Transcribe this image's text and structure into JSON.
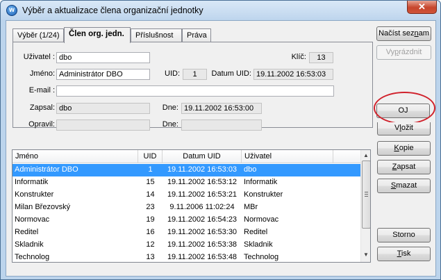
{
  "window": {
    "title": "Výběr a aktualizace člena organizační jednotky",
    "close_symbol": "✕",
    "app_icon_letter": "w"
  },
  "tabs": [
    {
      "label": "Výběr (1/24)"
    },
    {
      "label": "Člen org. jedn."
    },
    {
      "label": "Příslušnost"
    },
    {
      "label": "Práva"
    }
  ],
  "form": {
    "uzivatel_label": "Uživatel :",
    "uzivatel_value": "dbo",
    "klic_label": "Klíč:",
    "klic_value": "13",
    "jmeno_label": "Jméno:",
    "jmeno_value": "Administrátor DBO",
    "uid_label": "UID:",
    "uid_value": "1",
    "datum_uid_label": "Datum UID:",
    "datum_uid_value": "19.11.2002 16:53:03",
    "email_label": "E-mail :",
    "email_value": "",
    "zapsal_label": "Zapsal:",
    "zapsal_value": "dbo",
    "dne1_label": "Dne:",
    "dne1_value": "19.11.2002 16:53:00",
    "opravil_label": "Opravil:",
    "opravil_value": "",
    "dne2_label": "Dne:",
    "dne2_value": ""
  },
  "grid": {
    "columns": [
      "Jméno",
      "UID",
      "Datum UID",
      "Uživatel"
    ],
    "rows": [
      {
        "jmeno": "Administrátor DBO",
        "uid": "1",
        "datum": "19.11.2002 16:53:03",
        "uzivatel": "dbo"
      },
      {
        "jmeno": "Informatik",
        "uid": "15",
        "datum": "19.11.2002 16:53:12",
        "uzivatel": "Informatik"
      },
      {
        "jmeno": "Konstrukter",
        "uid": "14",
        "datum": "19.11.2002 16:53:21",
        "uzivatel": "Konstrukter"
      },
      {
        "jmeno": "Milan Březovský",
        "uid": "23",
        "datum": "9.11.2006 11:02:24",
        "uzivatel": "MBr"
      },
      {
        "jmeno": "Normovac",
        "uid": "19",
        "datum": "19.11.2002 16:54:23",
        "uzivatel": "Normovac"
      },
      {
        "jmeno": "Reditel",
        "uid": "16",
        "datum": "19.11.2002 16:53:30",
        "uzivatel": "Reditel"
      },
      {
        "jmeno": "Skladnik",
        "uid": "12",
        "datum": "19.11.2002 16:53:38",
        "uzivatel": "Skladnik"
      },
      {
        "jmeno": "Technolog",
        "uid": "13",
        "datum": "19.11.2002 16:53:48",
        "uzivatel": "Technolog"
      }
    ],
    "selected_index": 0
  },
  "buttons": {
    "nacist": {
      "pre": "Načíst sez",
      "u": "n",
      "post": "am"
    },
    "vyprazdnit": {
      "pre": "Vy",
      "u": "p",
      "post": "rázdnit"
    },
    "oj": {
      "pre": "OJ",
      "u": "",
      "post": ""
    },
    "vlozit": {
      "pre": "V",
      "u": "l",
      "post": "ožit"
    },
    "kopie": {
      "pre": "",
      "u": "K",
      "post": "opie"
    },
    "zapsat": {
      "pre": "",
      "u": "Z",
      "post": "apsat"
    },
    "smazat": {
      "pre": "",
      "u": "S",
      "post": "mazat"
    },
    "storno": {
      "pre": "Storno",
      "u": "",
      "post": ""
    },
    "tisk": {
      "pre": "",
      "u": "T",
      "post": "isk"
    }
  },
  "colors": {
    "selection": "#3399ff",
    "highlight_ring": "#d0212b",
    "close_button": "#c6452c"
  }
}
